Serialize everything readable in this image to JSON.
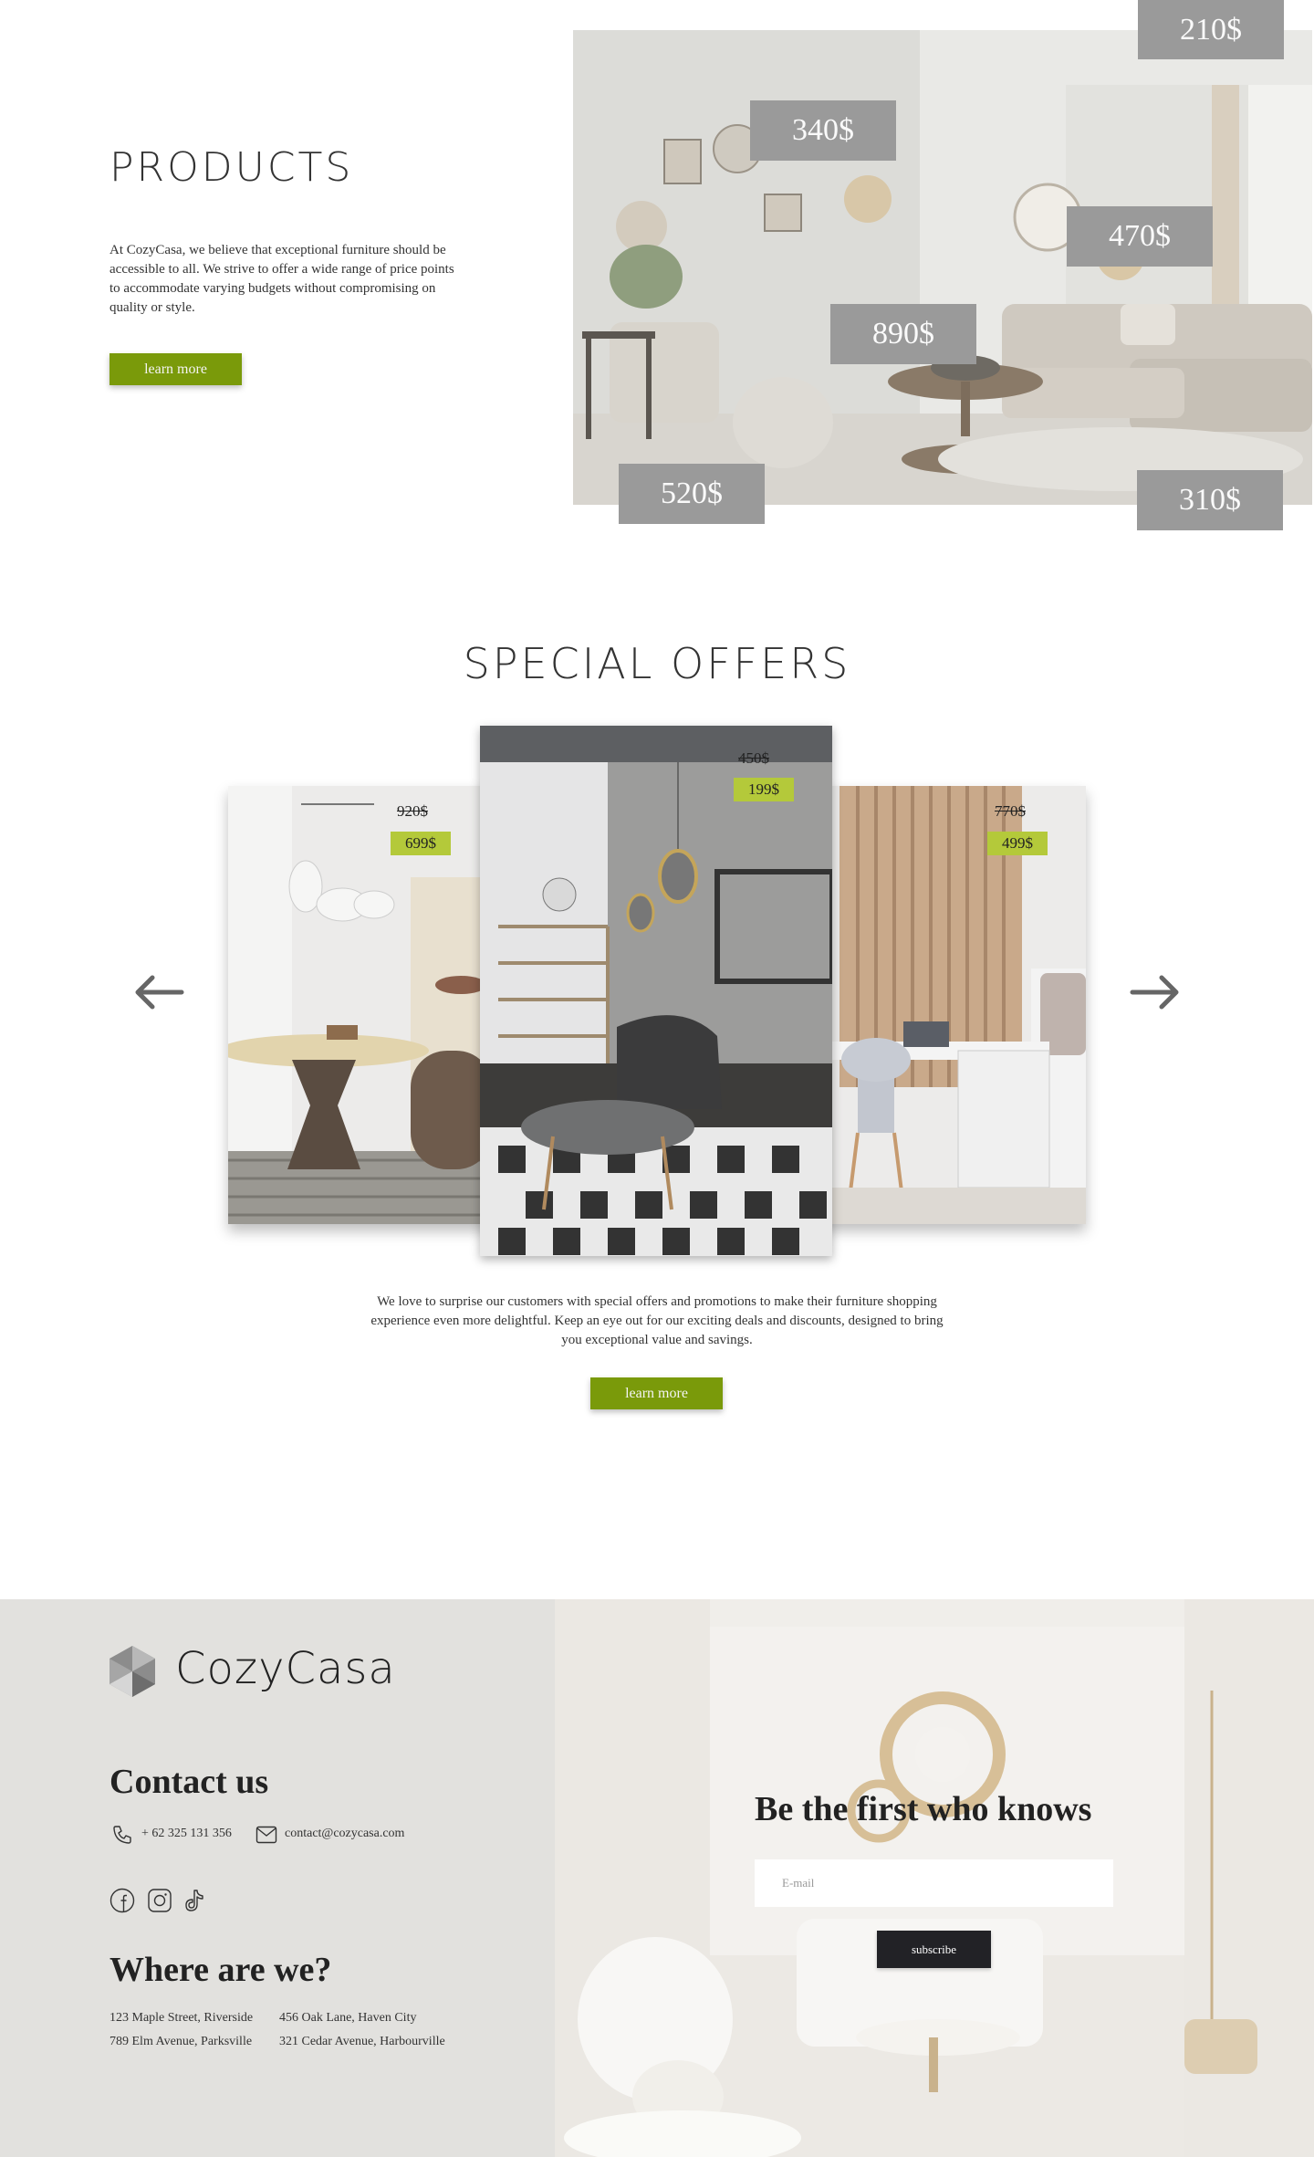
{
  "products": {
    "title": "PRODUCTS",
    "description": "At CozyCasa, we believe that exceptional furniture should be accessible to all. We strive to offer a wide range of price points to accommodate varying budgets without compromising on quality or style.",
    "button_label": "learn more",
    "prices": [
      "210$",
      "340$",
      "470$",
      "890$",
      "520$",
      "310$"
    ]
  },
  "offers": {
    "title": "SPECIAL OFFERS",
    "cards": [
      {
        "old_price": "920$",
        "new_price": "699$"
      },
      {
        "old_price": "450$",
        "new_price": "199$"
      },
      {
        "old_price": "770$",
        "new_price": "499$"
      }
    ],
    "description": "We love to surprise our customers with special offers and promotions to make their furniture shopping experience even more delightful. Keep an eye out for our exciting deals and discounts, designed to bring you exceptional value and savings.",
    "button_label": "learn more"
  },
  "footer": {
    "brand": "CozyCasa",
    "contact_title": "Contact us",
    "phone": "+ 62 325 131 356",
    "email": "contact@cozycasa.com",
    "location_title": "Where are we?",
    "addresses": [
      "123 Maple Street, Riverside",
      "456 Oak Lane, Haven City",
      "789 Elm Avenue, Parksville",
      "321 Cedar Avenue, Harbourville"
    ],
    "newsletter_title": "Be the first who knows",
    "email_placeholder": "E-mail",
    "subscribe_label": "subscribe"
  },
  "icons": [
    "phone-icon",
    "mail-icon",
    "facebook-icon",
    "instagram-icon",
    "tiktok-icon",
    "arrow-left-icon",
    "arrow-right-icon",
    "logo-icon"
  ],
  "colors": {
    "accent_green": "#7a9a0a",
    "price_highlight": "#b4c93a",
    "price_tag_gray": "#9a9a9a",
    "subscribe_dark": "#222226"
  }
}
